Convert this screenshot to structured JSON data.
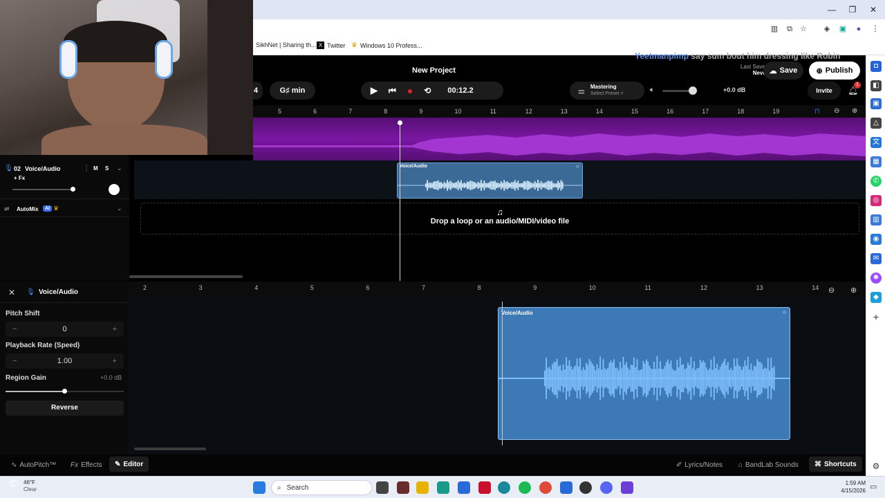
{
  "browser": {
    "bookmarks": [
      {
        "label": "SikhNet | Sharing th...",
        "icon": "sikhnet-icon"
      },
      {
        "label": "Twitter",
        "icon": "x-logo-icon"
      },
      {
        "label": "Windows 10 Profess...",
        "icon": "crown-icon"
      }
    ]
  },
  "app": {
    "project_title": "New Project",
    "key_fragment": "4",
    "key_label": "G♯ min",
    "time_display": "00:12.2",
    "mastering_label": "Mastering",
    "preset_label": "Select Preset >",
    "master_volume": "+0.0 dB",
    "invite_label": "Invite",
    "notification_count": "1",
    "last_saved_label": "Last Saved",
    "last_saved_value": "Never",
    "save_label": "Save",
    "publish_label": "Publish",
    "chat_username": "Yeetmanpimp",
    "chat_message": "say sum bout him dressing like Robin",
    "accent_color": "#7b17a8",
    "region_color": "#3f8fd8"
  },
  "timeline": {
    "ruler_ticks": [
      "5",
      "6",
      "7",
      "8",
      "9",
      "10",
      "11",
      "12",
      "13",
      "14",
      "15",
      "16",
      "17",
      "18",
      "19"
    ],
    "playhead_time": "00:12.2"
  },
  "tracks": {
    "track2": {
      "number": "02",
      "name": "Voice/Audio",
      "mute": "M",
      "solo": "S",
      "fx": "+ Fx",
      "region_label": "Voice/Audio"
    },
    "automix": {
      "label": "AutoMix",
      "badge": "AI"
    },
    "dropzone_text": "Drop a loop or an audio/MIDI/video file"
  },
  "editor": {
    "title": "Voice/Audio",
    "pitch_shift_label": "Pitch Shift",
    "pitch_shift_value": "0",
    "playback_rate_label": "Playback Rate (Speed)",
    "playback_rate_value": "1.00",
    "region_gain_label": "Region Gain",
    "region_gain_value": "+0.0 dB",
    "reverse_label": "Reverse",
    "ruler_ticks": [
      "2",
      "3",
      "4",
      "5",
      "6",
      "7",
      "8",
      "9",
      "10",
      "11",
      "12",
      "13",
      "14"
    ],
    "region_label": "Voice/Audio",
    "minus": "−",
    "plus": "+"
  },
  "bottom_bar": {
    "autopitch": "AutoPitch™",
    "effects": "Effects",
    "editor": "Editor",
    "lyrics": "Lyrics/Notes",
    "sounds": "BandLab Sounds",
    "shortcuts": "Shortcuts"
  },
  "taskbar": {
    "temperature": "46°F",
    "weather": "Clear",
    "search_placeholder": "Search",
    "time": "1:59 AM",
    "date": "4/15/2026"
  }
}
